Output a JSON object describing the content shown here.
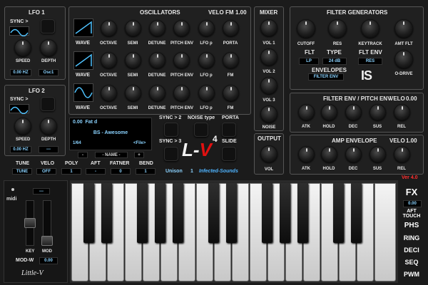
{
  "lfo1": {
    "title": "LFO 1",
    "sync": "SYNC >",
    "speed": "SPEED",
    "depth": "DEPTH",
    "speed_value": "0.00 HZ",
    "depth_value": "Osc1"
  },
  "lfo2": {
    "title": "LFO 2",
    "sync": "SYNC >",
    "speed": "SPEED",
    "depth": "DEPTH",
    "speed_value": "0.00 HZ",
    "depth_value": "---"
  },
  "osc": {
    "title": "OSCILLATORS",
    "velo_fm": "VELO FM",
    "velo_fm_value": "1.00",
    "wave": "WAVE",
    "row1": [
      "OCTAVE",
      "SEMI",
      "DETUNE",
      "PITCH ENV",
      "LFO p",
      "PORTA"
    ],
    "row2": [
      "OCTAVE",
      "SEMI",
      "DETUNE",
      "PITCH ENV",
      "LFO p",
      "FM"
    ],
    "row3": [
      "OCTAVE",
      "SEMI",
      "DETUNE",
      "PITCH ENV",
      "LFO p",
      "FM"
    ]
  },
  "mixer": {
    "title": "MIXER",
    "labels": [
      "VOL 1",
      "VOL 2",
      "VOL 3",
      "NOISE"
    ]
  },
  "output": {
    "title": "OUTPUT",
    "vol": "VOL"
  },
  "filter": {
    "title": "FILTER GENERATORS",
    "knobs": [
      "CUTOFF",
      "RES",
      "KEYTRACK",
      "AMT FLT"
    ],
    "flt": "FLT",
    "type": "TYPE",
    "flt_env": "FLT ENV",
    "flt_value": "LP",
    "type_value": "24 dB",
    "flt_env_value": "RES",
    "envelopes": "ENVELOPES",
    "envelopes_value": "FILTER ENV",
    "odrive": "O-DRIVE"
  },
  "filter_env": {
    "title": "FILTER ENV / PITCH ENV",
    "velo": "VELO",
    "velo_value": "0.00",
    "knobs": [
      "ATK",
      "HOLD",
      "DEC",
      "SUS",
      "REL"
    ]
  },
  "amp_env": {
    "title": "AMP ENVELOPE",
    "velo": "VELO",
    "velo_value": "1.00",
    "knobs": [
      "ATK",
      "HOLD",
      "DEC",
      "SUS",
      "REL"
    ]
  },
  "preset": {
    "line1": "0.00  Fat d",
    "name": "BS - Awesome",
    "counter": "1/64",
    "file": "<File>",
    "prev": "-",
    "name_button": "- NAME -",
    "next": "+"
  },
  "switches": {
    "sync2": "SYNC > 2",
    "noise_type": "NOISE type",
    "porta": "PORTA",
    "sync3": "SYNC > 3",
    "slide": "SLIDE"
  },
  "logo": {
    "text_l": "L-",
    "text_v": "V",
    "sup": "4",
    "unison": "Unison",
    "unison_value": "1",
    "credit": "Infected-Sounds",
    "version": "Ver 4.0",
    "is_logo": "IS"
  },
  "bottom": {
    "labels": [
      "TUNE",
      "VELO",
      "POLY",
      "AFT",
      "FATNER",
      "BEND"
    ],
    "values": [
      "TUNE",
      "OFF",
      "1",
      "-",
      "0",
      "1"
    ]
  },
  "left": {
    "midi": "midi",
    "midi_value": "---",
    "key": "KEY",
    "mod": "MOD",
    "modw": "MOD-W",
    "modw_value": "0.00",
    "signature": "Little-V"
  },
  "side": {
    "fx": "FX",
    "aft_value": "0.00",
    "aft_touch_1": "AFT",
    "aft_touch_2": "TOUCH",
    "phs": "PHS",
    "ring": "RING",
    "deci": "DECI",
    "seq": "SEQ",
    "pwm": "PWM"
  },
  "colors": {
    "accent_blue": "#8bd3ff",
    "logo_red": "#e01010",
    "version_red": "#ff3030",
    "credit_blue": "#4fb4ff"
  }
}
